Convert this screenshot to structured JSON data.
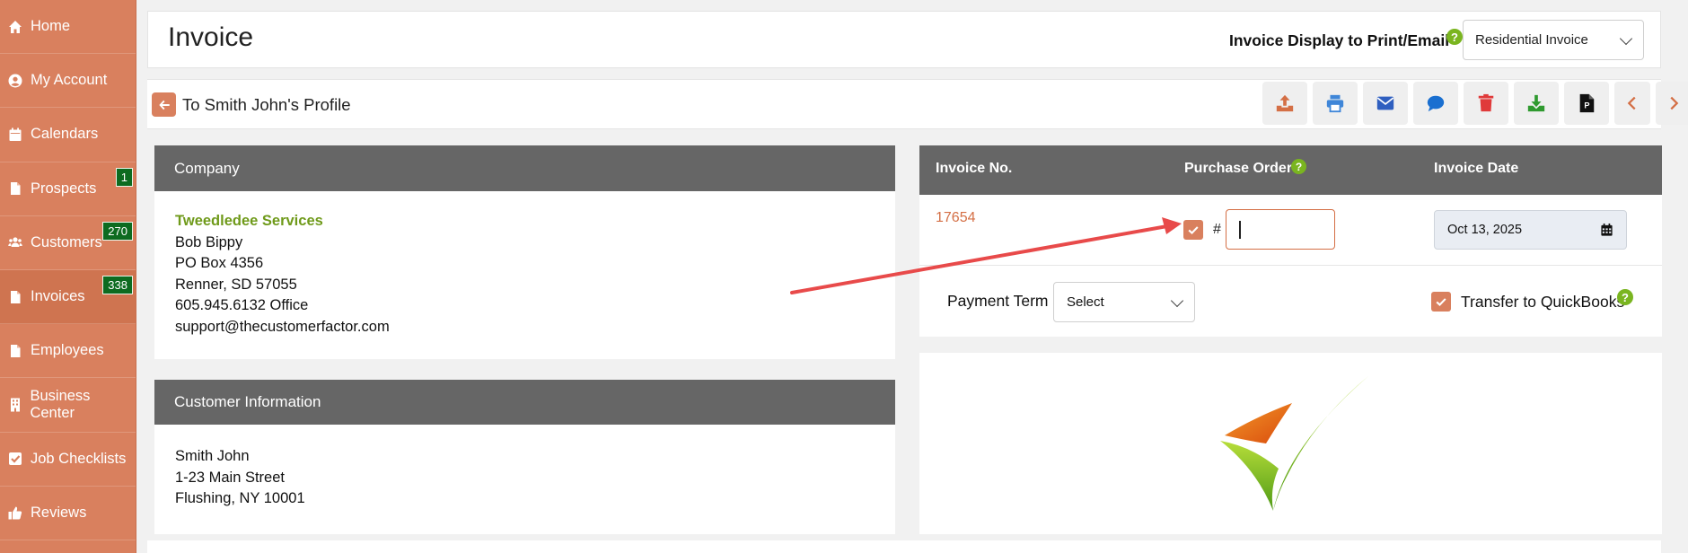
{
  "sidebar": {
    "items": [
      {
        "label": "Home",
        "icon": "home-icon",
        "badge": ""
      },
      {
        "label": "My Account",
        "icon": "user-circle-icon",
        "badge": ""
      },
      {
        "label": "Calendars",
        "icon": "calendar-icon",
        "badge": ""
      },
      {
        "label": "Prospects",
        "icon": "document-icon",
        "badge": "1"
      },
      {
        "label": "Customers",
        "icon": "users-icon",
        "badge": "270"
      },
      {
        "label": "Invoices",
        "icon": "document-icon",
        "badge": "338"
      },
      {
        "label": "Employees",
        "icon": "document-icon",
        "badge": ""
      },
      {
        "label": "Business Center",
        "icon": "building-icon",
        "badge": ""
      },
      {
        "label": "Job Checklists",
        "icon": "checkbox-icon",
        "badge": ""
      },
      {
        "label": "Reviews",
        "icon": "thumbs-up-icon",
        "badge": ""
      }
    ]
  },
  "header": {
    "title": "Invoice",
    "display_label": "Invoice Display to Print/Email",
    "help": "?",
    "display_select": "Residential Invoice"
  },
  "toolbar": {
    "back_label": "To Smith John's Profile",
    "buttons": [
      "upload-icon",
      "print-icon",
      "email-icon",
      "chat-icon",
      "trash-icon",
      "download-icon",
      "pdf-icon",
      "chevron-left-icon",
      "chevron-right-icon"
    ]
  },
  "company": {
    "heading": "Company",
    "name": "Tweedledee Services",
    "contact": "Bob Bippy",
    "address1": "PO Box 4356",
    "address2": "Renner, SD 57055",
    "phone": "605.945.6132 Office",
    "email": "support@thecustomerfactor.com"
  },
  "customer": {
    "heading": "Customer Information",
    "name": "Smith John",
    "street": "1-23 Main Street",
    "city": "Flushing, NY 10001"
  },
  "invoice": {
    "col_no": "Invoice No.",
    "col_po": "Purchase Order",
    "col_date": "Invoice Date",
    "number": "17654",
    "po_hash": "#",
    "po_value": "",
    "date": "Oct 13, 2025",
    "term_label": "Payment Term",
    "term_select": "Select",
    "qb_label": "Transfer to QuickBooks"
  },
  "colors": {
    "accent": "#d9805e",
    "badge": "#0d6b20",
    "head": "#666666",
    "company_name": "#6f9a1a",
    "arrow": "#e84a4a"
  }
}
